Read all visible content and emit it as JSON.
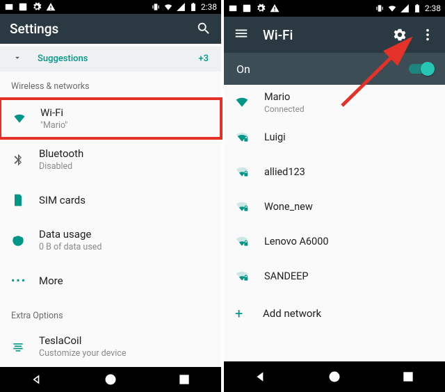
{
  "status": {
    "time": "2:38"
  },
  "left": {
    "title": "Settings",
    "suggestions": {
      "label": "Suggestions",
      "count": "+3"
    },
    "section1": "Wireless & networks",
    "wifi": {
      "label": "Wi-Fi",
      "sub": "\"Mario\""
    },
    "bt": {
      "label": "Bluetooth",
      "sub": "Disabled"
    },
    "sim": {
      "label": "SIM cards"
    },
    "data": {
      "label": "Data usage",
      "sub": "0 B of data used"
    },
    "more": {
      "label": "More"
    },
    "section2": "Extra Options",
    "tesla": {
      "label": "TeslaCoil",
      "sub": "Customize your device"
    }
  },
  "right": {
    "title": "Wi-Fi",
    "state": "On",
    "networks": [
      {
        "name": "Mario",
        "sub": "Connected",
        "strength": 4,
        "lock": false
      },
      {
        "name": "Luigi",
        "sub": "",
        "strength": 3,
        "lock": true
      },
      {
        "name": "allied123",
        "sub": "",
        "strength": 2,
        "lock": true
      },
      {
        "name": "Wone_new",
        "sub": "",
        "strength": 2,
        "lock": true
      },
      {
        "name": "Lenovo A6000",
        "sub": "",
        "strength": 2,
        "lock": true
      },
      {
        "name": "SANDEEP",
        "sub": "",
        "strength": 2,
        "lock": true
      }
    ],
    "add": "Add network"
  }
}
